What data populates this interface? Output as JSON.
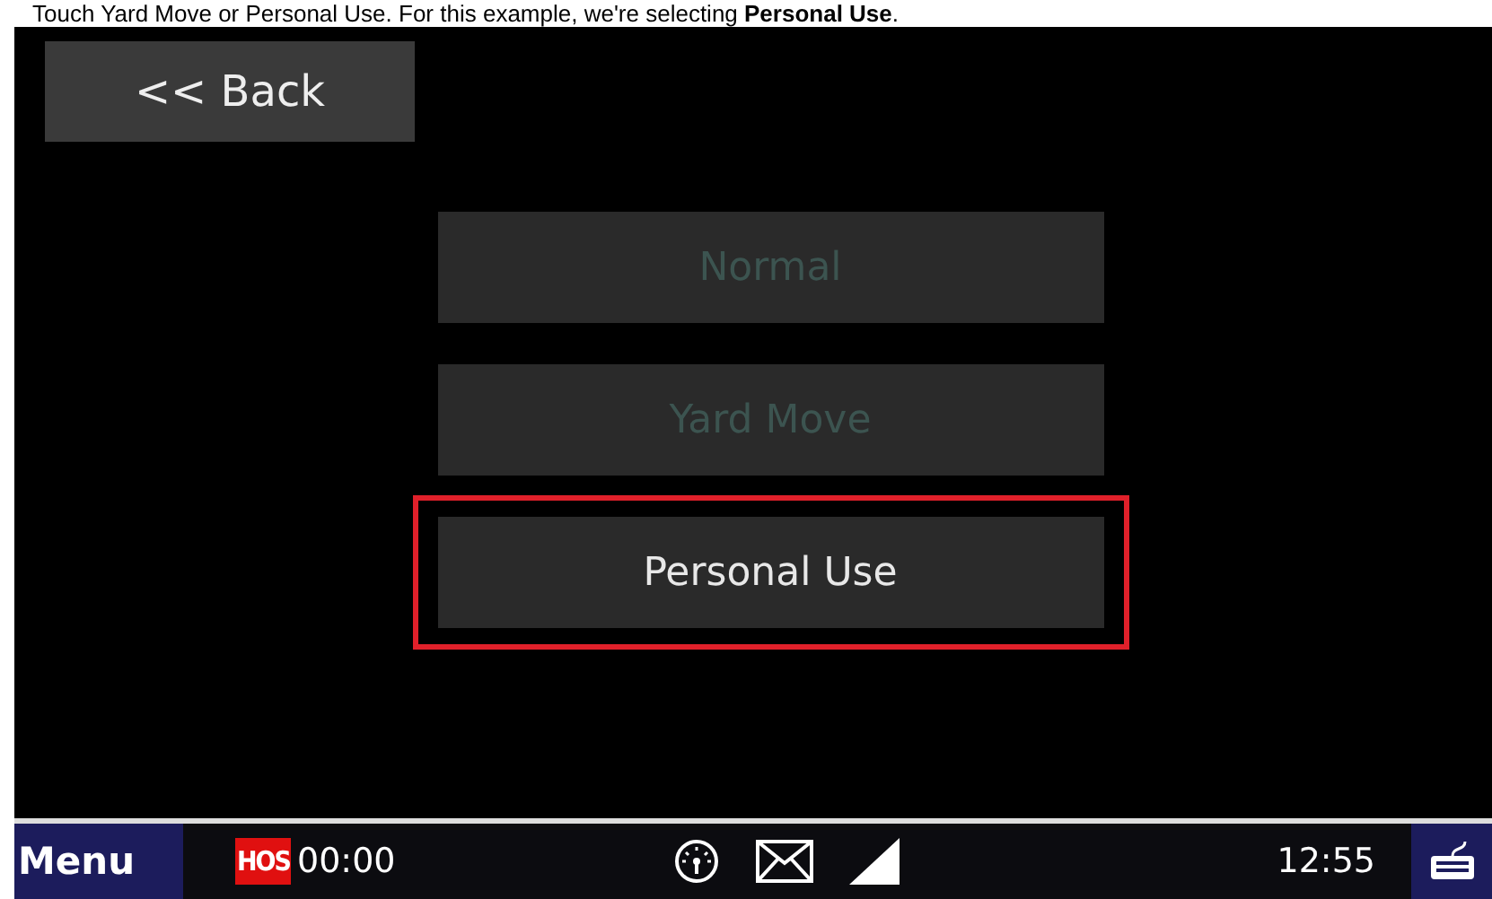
{
  "caption": "Touch Yard Move or Personal Use. For this example, we're selecting **Personal Use**.",
  "back_button": {
    "label": "<< Back"
  },
  "options": [
    {
      "label": "Normal",
      "disabled": true,
      "highlighted": false
    },
    {
      "label": "Yard Move",
      "disabled": true,
      "highlighted": false
    },
    {
      "label": "Personal Use",
      "disabled": false,
      "highlighted": true
    }
  ],
  "status_bar": {
    "menu": "Menu",
    "hos_badge": "HOS",
    "hos_time": "00:00",
    "clock": "12:55"
  }
}
